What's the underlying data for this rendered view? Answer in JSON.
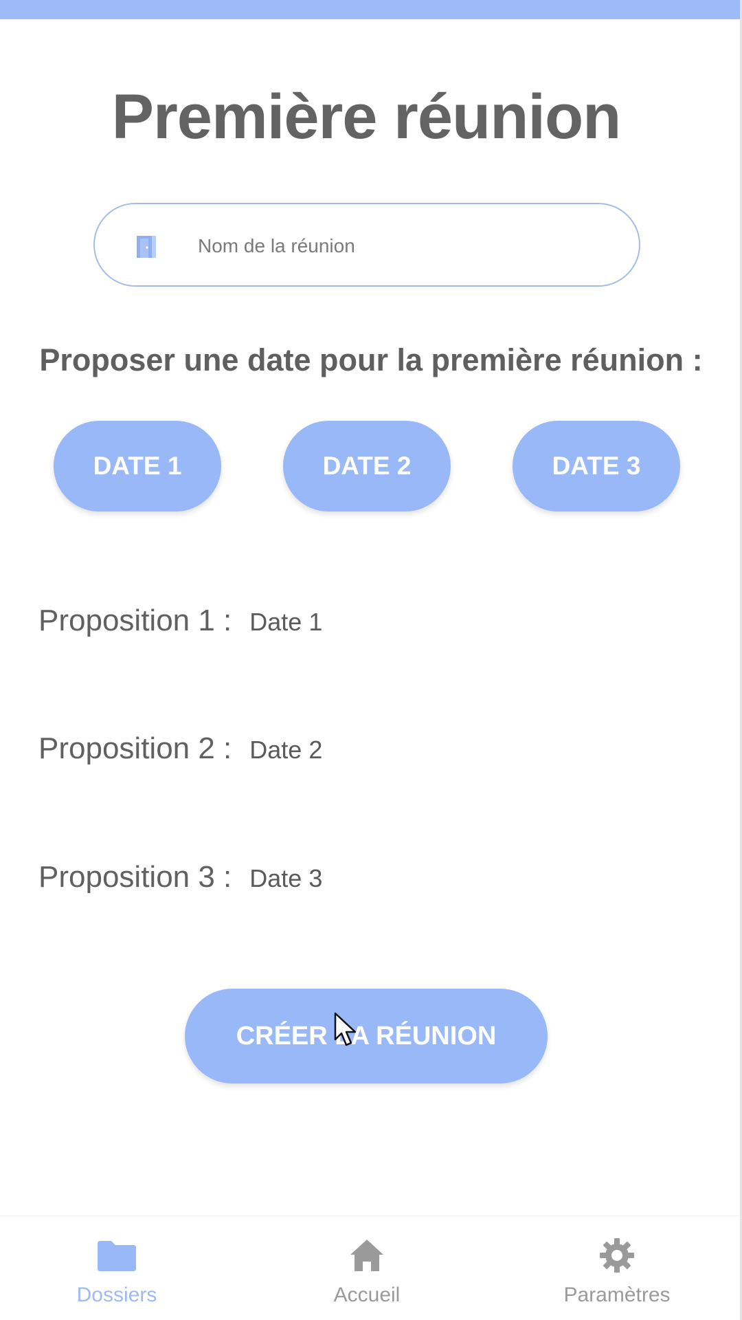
{
  "header": {
    "title": "Première réunion"
  },
  "meeting_name": {
    "placeholder": "Nom de la réunion",
    "value": "",
    "icon": "door-icon"
  },
  "propose_label": "Proposer une date pour la première réunion :",
  "date_buttons": [
    {
      "label": "DATE 1"
    },
    {
      "label": "DATE 2"
    },
    {
      "label": "DATE 3"
    }
  ],
  "propositions": [
    {
      "label": "Proposition 1 :",
      "value": "Date 1"
    },
    {
      "label": "Proposition 2 :",
      "value": "Date 2"
    },
    {
      "label": "Proposition 3 :",
      "value": "Date 3"
    }
  ],
  "create_button": {
    "label": "CRÉER LA RÉUNION"
  },
  "bottom_nav": {
    "items": [
      {
        "label": "Dossiers",
        "icon": "folder-icon",
        "active": true
      },
      {
        "label": "Accueil",
        "icon": "home-icon",
        "active": false
      },
      {
        "label": "Paramètres",
        "icon": "gear-icon",
        "active": false
      }
    ]
  },
  "colors": {
    "accent": "#99b8f7",
    "top_bar": "#9dbbf8",
    "title_text": "#636363",
    "nav_active": "#9dbbf0",
    "nav_inactive": "#9a9a9a"
  }
}
